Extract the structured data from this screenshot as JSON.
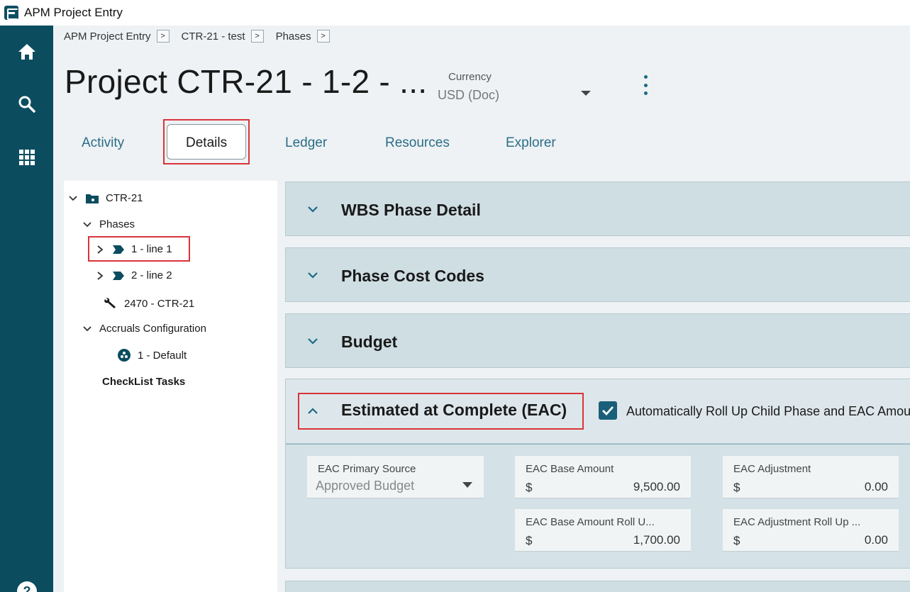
{
  "window": {
    "title": "APM Project Entry"
  },
  "nav": {
    "items": [
      "home-icon",
      "search-icon",
      "apps-icon",
      "help-icon"
    ]
  },
  "breadcrumb": {
    "items": [
      "APM Project Entry",
      "CTR-21 - test",
      "Phases"
    ]
  },
  "header": {
    "title": "Project CTR-21 - 1-2 - ...",
    "currency_label": "Currency",
    "currency_value": "USD (Doc)"
  },
  "tabs": [
    {
      "label": "Activity",
      "active": false
    },
    {
      "label": "Details",
      "active": true
    },
    {
      "label": "Ledger",
      "active": false
    },
    {
      "label": "Resources",
      "active": false
    },
    {
      "label": "Explorer",
      "active": false
    }
  ],
  "tree": {
    "root": "CTR-21",
    "phases": "Phases",
    "phase1": "1 - line 1",
    "phase2": "2 - line 2",
    "tool": "2470 - CTR-21",
    "accruals": "Accruals Configuration",
    "accrual_default": "1 - Default",
    "checklist": "CheckList Tasks"
  },
  "sections": {
    "wbs": "WBS Phase Detail",
    "cost_codes": "Phase Cost Codes",
    "budget": "Budget",
    "eac": "Estimated at Complete (EAC)",
    "rollup_label": "Automatically Roll Up Child Phase and EAC Amounts",
    "rollup_checked": true
  },
  "eac_fields": {
    "primary_source_label": "EAC Primary Source",
    "primary_source_value": "Approved Budget",
    "base_amount_label": "EAC Base Amount",
    "base_amount_currency": "$",
    "base_amount_value": "9,500.00",
    "adjustment_label": "EAC Adjustment",
    "adjustment_currency": "$",
    "adjustment_value": "0.00",
    "base_rollup_label": "EAC Base Amount Roll U...",
    "base_rollup_currency": "$",
    "base_rollup_value": "1,700.00",
    "adjustment_rollup_label": "EAC Adjustment Roll Up ...",
    "adjustment_rollup_currency": "$",
    "adjustment_rollup_value": "0.00"
  },
  "colors": {
    "rail": "#0b4d5f",
    "accent": "#2b6d88",
    "highlight": "#d9343a",
    "section": "#cfdee3"
  }
}
